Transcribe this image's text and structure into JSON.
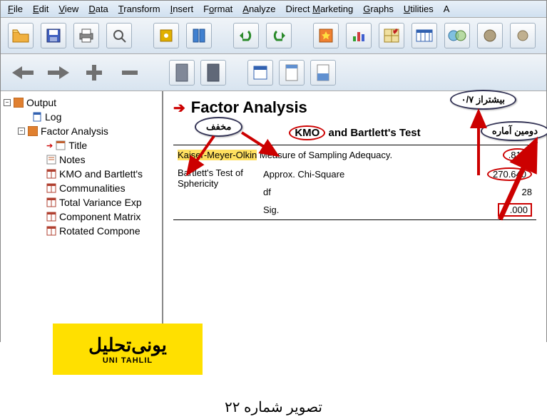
{
  "menubar": [
    "File",
    "Edit",
    "View",
    "Data",
    "Transform",
    "Insert",
    "Format",
    "Analyze",
    "Direct Marketing",
    "Graphs",
    "Utilities",
    "A"
  ],
  "tree": {
    "output": "Output",
    "log": "Log",
    "fa": "Factor Analysis",
    "items": [
      "Title",
      "Notes",
      "KMO and Bartlett's",
      "Communalities",
      "Total Variance Exp",
      "Component Matrix",
      "Rotated Compone"
    ]
  },
  "main": {
    "heading": "Factor Analysis",
    "subhead_kmo": "KMO",
    "subhead_rest": " and Bartlett's Test",
    "row1_label": "Kaiser-Meyer-Olkin Measure of Sampling Adequacy.",
    "row1_hl": "Kaiser-Meyer-Olkin",
    "row1_val": ".818",
    "row2_label": "Bartlett's Test of Sphericity",
    "row2a": "Approx. Chi-Square",
    "row2a_val": "270.640",
    "row2b": "df",
    "row2b_val": "28",
    "row2c": "Sig.",
    "row2c_val": ".000"
  },
  "bubbles": {
    "mokhafaf": "مخفف",
    "bishtar": "بیشتراز ۰/۷",
    "dovomin": "دومین آماره"
  },
  "logo": {
    "ar": "یونی‌تحلیل",
    "en": "UNI TAHLIL"
  },
  "caption": "تصویر شماره ۲۲"
}
